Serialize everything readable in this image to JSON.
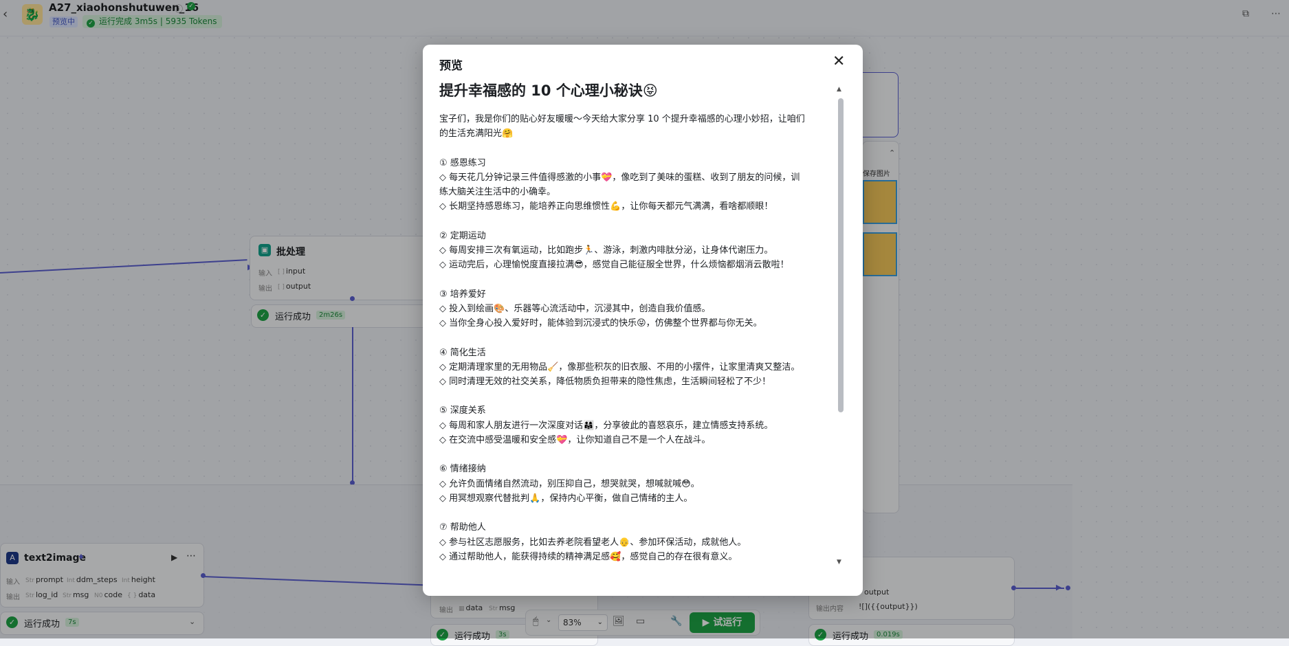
{
  "header": {
    "workflow_name": "A27_xiaohonshutuwen_16",
    "preview_badge": "预览中",
    "run_status": "运行完成 3m5s | 5935 Tokens"
  },
  "nodes": {
    "batch": {
      "title": "批处理",
      "input_label": "输入",
      "input_type": "[ ]",
      "input_value": "input",
      "output_label": "输出",
      "output_type": "[ ]",
      "output_value": "output",
      "status": "运行成功",
      "time": "2m26s"
    },
    "text2image": {
      "title": "text2image",
      "input_label": "输入",
      "in1_type": "Str",
      "in1": "prompt",
      "in2_type": "Int",
      "in2": "ddm_steps",
      "in3_type": "Int",
      "in3": "height",
      "output_label": "输出",
      "out1_type": "Str",
      "out1": "log_id",
      "out2_type": "Str",
      "out2": "msg",
      "out3_type": "N0",
      "out3": "code",
      "out4_type": "{ }",
      "out4": "data",
      "status": "运行成功",
      "time": "7s"
    },
    "middle_bottom": {
      "output_label": "输出",
      "out1": "data",
      "out2_type": "Str",
      "out2": "msg",
      "status": "运行成功",
      "time": "3s"
    },
    "right_bottom": {
      "tag": "output",
      "label": "输出内容",
      "value": "![]({{output}})",
      "status": "运行成功",
      "time": "0.019s"
    },
    "right_panel": {
      "save_label": "保存图片"
    }
  },
  "toolbar": {
    "zoom": "83%",
    "run_label": "试运行"
  },
  "modal": {
    "title": "预览",
    "article_title": "提升幸福感的 10 个心理小秘诀😝",
    "paragraphs": [
      [
        "宝子们，我是你们的贴心好友暖暖～今天给大家分享 10 个提升幸福感的心理小妙招，让咱们",
        "的生活充满阳光🤗"
      ],
      [
        "① 感恩练习",
        "◇ 每天花几分钟记录三件值得感激的小事💝，像吃到了美味的蛋糕、收到了朋友的问候，训",
        "练大脑关注生活中的小确幸。",
        "◇ 长期坚持感恩练习，能培养正向思维惯性💪，让你每天都元气满满，看啥都顺眼！"
      ],
      [
        "② 定期运动",
        "◇ 每周安排三次有氧运动，比如跑步🏃、游泳，刺激内啡肽分泌，让身体代谢压力。",
        "◇ 运动完后，心理愉悦度直接拉满😎，感觉自己能征服全世界，什么烦恼都烟消云散啦！"
      ],
      [
        "③ 培养爱好",
        "◇ 投入到绘画🎨、乐器等心流活动中，沉浸其中，创造自我价值感。",
        "◇ 当你全身心投入爱好时，能体验到沉浸式的快乐😝，仿佛整个世界都与你无关。"
      ],
      [
        "④ 简化生活",
        "◇ 定期清理家里的无用物品🧹，像那些积灰的旧衣服、不用的小摆件，让家里清爽又整洁。",
        "◇ 同时清理无效的社交关系，降低物质负担带来的隐性焦虑，生活瞬间轻松了不少！"
      ],
      [
        "⑤ 深度关系",
        "◇ 每周和家人朋友进行一次深度对话👨‍👩‍👧，分享彼此的喜怒哀乐，建立情感支持系统。",
        "◇ 在交流中感受温暖和安全感💝，让你知道自己不是一个人在战斗。"
      ],
      [
        "⑥ 情绪接纳",
        "◇ 允许负面情绪自然流动，别压抑自己，想哭就哭，想喊就喊😳。",
        "◇ 用冥想观察代替批判🙏，保持内心平衡，做自己情绪的主人。"
      ],
      [
        "⑦ 帮助他人",
        "◇ 参与社区志愿服务，比如去养老院看望老人👴、参加环保活动，成就他人。",
        "◇ 通过帮助他人，能获得持续的精神满足感🥰，感觉自己的存在很有意义。"
      ]
    ]
  }
}
